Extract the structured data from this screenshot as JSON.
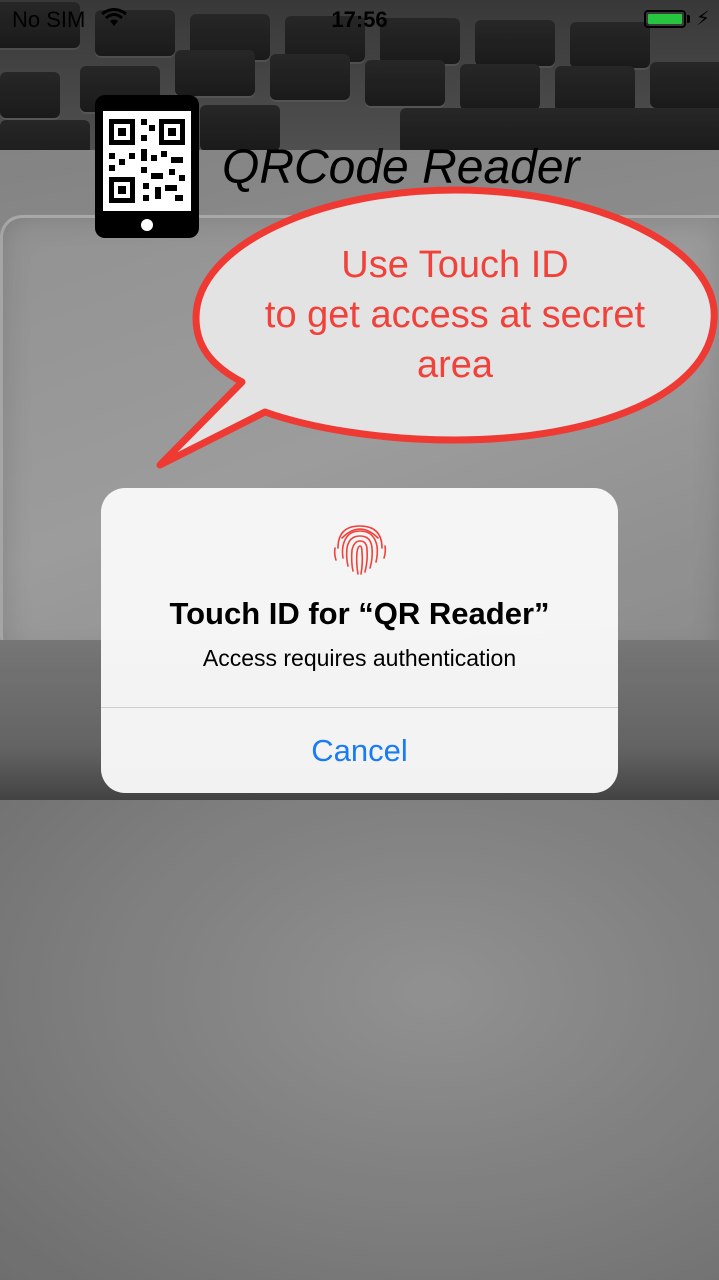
{
  "status_bar": {
    "carrier": "No SIM",
    "time": "17:56",
    "wifi_icon": "wifi-icon",
    "battery_icon": "battery-icon",
    "charging_icon": "charging-bolt-icon"
  },
  "app": {
    "title": "QRCode Reader",
    "logo_icon": "qr-phone-icon"
  },
  "callout": {
    "line1": "Use Touch ID",
    "line2": "to get access at secret",
    "line3": "area",
    "color": "#f0413a"
  },
  "touch_id_alert": {
    "icon": "fingerprint-icon",
    "title": "Touch ID for “QR Reader”",
    "message": "Access requires authentication",
    "cancel_label": "Cancel",
    "accent": "#1a7cf4"
  }
}
